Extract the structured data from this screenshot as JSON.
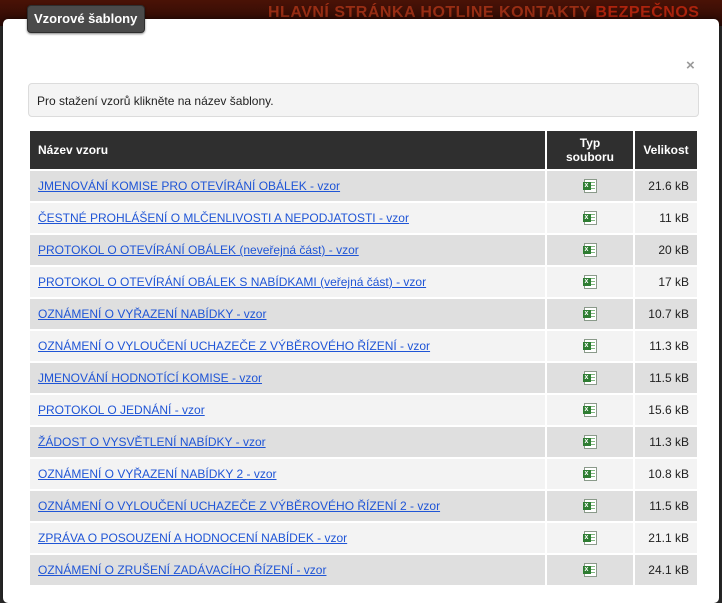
{
  "background": {
    "nav_text": "HLAVNÍ STRÁNKA  HOTLINE  KONTAKTY",
    "nav_text_alt": "BEZPEČNOS"
  },
  "modal": {
    "title": "Vzorové šablony",
    "close_label": "×",
    "info_text": "Pro stažení vzorů klikněte na název šablony."
  },
  "table": {
    "headers": {
      "name": "Název vzoru",
      "type": "Typ souboru",
      "size": "Velikost"
    },
    "rows": [
      {
        "name": "JMENOVÁNÍ KOMISE PRO OTEVÍRÁNÍ OBÁLEK - vzor",
        "type_icon": "excel-file-icon",
        "size": "21.6 kB"
      },
      {
        "name": "ČESTNÉ PROHLÁŠENÍ O MLČENLIVOSTI A NEPODJATOSTI - vzor",
        "type_icon": "excel-file-icon",
        "size": "11 kB"
      },
      {
        "name": "PROTOKOL O OTEVÍRÁNÍ OBÁLEK (neveřejná část) - vzor",
        "type_icon": "excel-file-icon",
        "size": "20 kB"
      },
      {
        "name": "PROTOKOL O OTEVÍRÁNÍ OBÁLEK S NABÍDKAMI (veřejná část) - vzor",
        "type_icon": "excel-file-icon",
        "size": "17 kB"
      },
      {
        "name": "OZNÁMENÍ O VYŘAZENÍ NABÍDKY - vzor",
        "type_icon": "excel-file-icon",
        "size": "10.7 kB"
      },
      {
        "name": "OZNÁMENÍ O VYLOUČENÍ UCHAZEČE Z VÝBĚROVÉHO ŘÍZENÍ - vzor",
        "type_icon": "excel-file-icon",
        "size": "11.3 kB"
      },
      {
        "name": "JMENOVÁNÍ HODNOTÍCÍ KOMISE - vzor",
        "type_icon": "excel-file-icon",
        "size": "11.5 kB"
      },
      {
        "name": "PROTOKOL O JEDNÁNÍ - vzor",
        "type_icon": "excel-file-icon",
        "size": "15.6 kB"
      },
      {
        "name": "ŽÁDOST O VYSVĚTLENÍ NABÍDKY - vzor",
        "type_icon": "excel-file-icon",
        "size": "11.3 kB"
      },
      {
        "name": "OZNÁMENÍ O VYŘAZENÍ NABÍDKY 2 - vzor",
        "type_icon": "excel-file-icon",
        "size": "10.8 kB"
      },
      {
        "name": "OZNÁMENÍ O VYLOUČENÍ UCHAZEČE Z VÝBĚROVÉHO ŘÍZENÍ 2 - vzor",
        "type_icon": "excel-file-icon",
        "size": "11.5 kB"
      },
      {
        "name": "ZPRÁVA O POSOUZENÍ A HODNOCENÍ NABÍDEK - vzor",
        "type_icon": "excel-file-icon",
        "size": "21.1 kB"
      },
      {
        "name": "OZNÁMENÍ O ZRUŠENÍ ZADÁVACÍHO ŘÍZENÍ - vzor",
        "type_icon": "excel-file-icon",
        "size": "24.1 kB"
      }
    ]
  }
}
